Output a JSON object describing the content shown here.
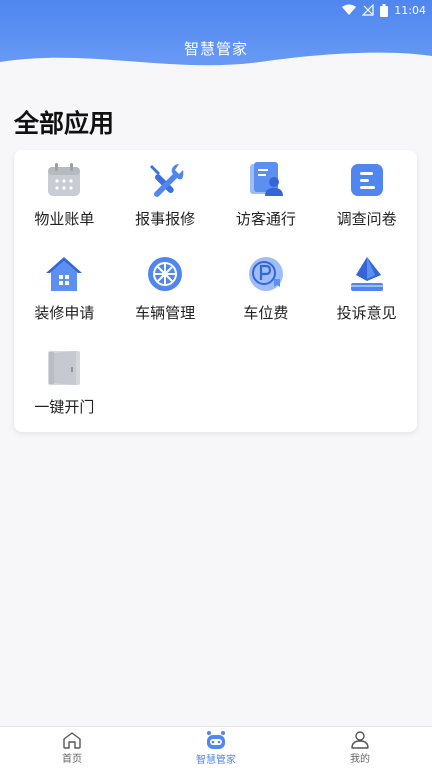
{
  "status_bar": {
    "time": "11:04"
  },
  "header": {
    "title": "智慧管家"
  },
  "section": {
    "title": "全部应用"
  },
  "apps": [
    {
      "label": "物业账单",
      "icon": "calendar-icon"
    },
    {
      "label": "报事报修",
      "icon": "tools-icon"
    },
    {
      "label": "访客通行",
      "icon": "visitor-icon"
    },
    {
      "label": "调查问卷",
      "icon": "survey-icon"
    },
    {
      "label": "装修申请",
      "icon": "house-icon"
    },
    {
      "label": "车辆管理",
      "icon": "wheel-icon"
    },
    {
      "label": "车位费",
      "icon": "parking-icon"
    },
    {
      "label": "投诉意见",
      "icon": "complaint-icon"
    },
    {
      "label": "一键开门",
      "icon": "door-icon"
    }
  ],
  "nav": [
    {
      "label": "首页",
      "icon": "home-icon",
      "active": false
    },
    {
      "label": "智慧管家",
      "icon": "robot-icon",
      "active": true
    },
    {
      "label": "我的",
      "icon": "user-icon",
      "active": false
    }
  ],
  "colors": {
    "primary": "#4f86ef",
    "header_light": "#6e9ff6",
    "background": "#f7f7f9"
  }
}
